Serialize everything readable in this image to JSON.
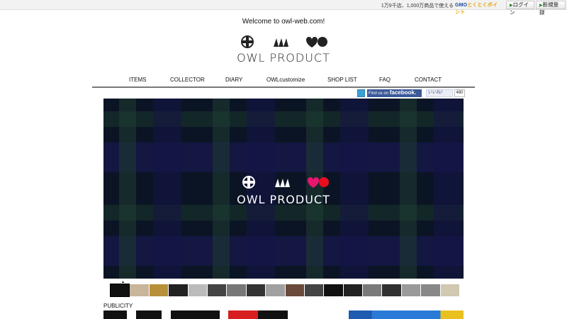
{
  "topbar": {
    "promo": "1万9千店、1,000万商品で使える",
    "gmo_left": "GMO",
    "gmo_right": "とくとくポイント",
    "login": "ログイン",
    "signup": "新規登録"
  },
  "welcome": "Welcome to owl-web.com!",
  "logo": {
    "text": "OWL PRODUCT"
  },
  "nav": {
    "items": [
      "ITEMS",
      "COLLECTOR",
      "DIARY",
      "OWLcustomize",
      "SHOP LIST",
      "FAQ",
      "CONTACT"
    ]
  },
  "social": {
    "facebook_small": "Find us on",
    "facebook_big": "facebook.",
    "like": "いいね！",
    "like_count": "480"
  },
  "hero": {
    "text": "OWL PRODUCT"
  },
  "section": {
    "publicity": "PUBLICITY"
  },
  "thumbs_colors": [
    "#111111",
    "#c9b59a",
    "#b8903a",
    "#222222",
    "#bbbbbb",
    "#444444",
    "#777777",
    "#333333",
    "#a0a0a0",
    "#6a4a3a",
    "#444444",
    "#111111",
    "#222222",
    "#7a7a7a",
    "#303030",
    "#9a9a9a",
    "#888888",
    "#d0c8b0"
  ]
}
